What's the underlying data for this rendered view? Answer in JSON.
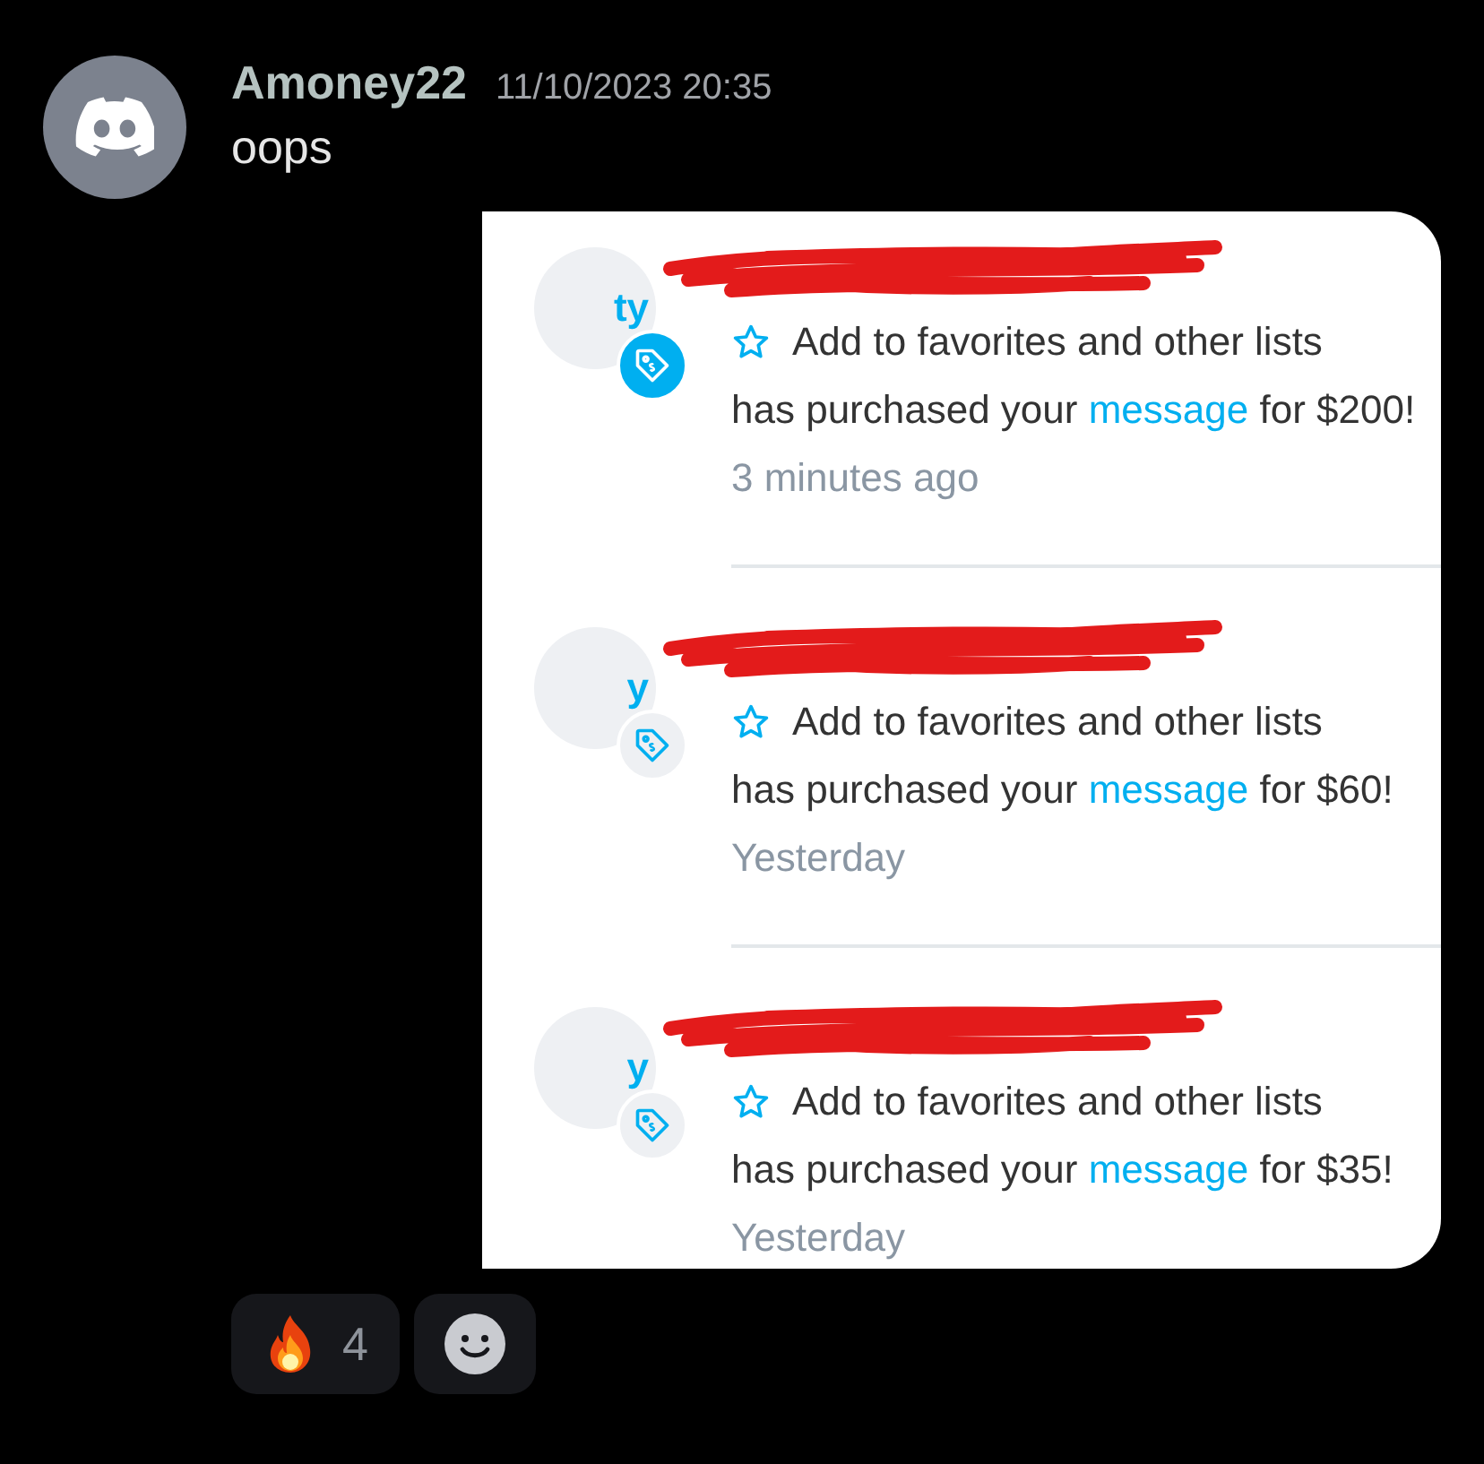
{
  "message": {
    "author": "Amoney22",
    "timestamp": "11/10/2023 20:35",
    "text": "oops"
  },
  "notifications": [
    {
      "avatar_fragment": "ty",
      "kind": "filled",
      "action": "Add to favorites and other lists",
      "before": "has purchased your",
      "link": "message",
      "after": "for $200!",
      "time": "3 minutes ago"
    },
    {
      "avatar_fragment": "y",
      "kind": "plain",
      "action": "Add to favorites and other lists",
      "before": "has purchased your",
      "link": "message",
      "after": "for $60!",
      "time": "Yesterday"
    },
    {
      "avatar_fragment": "y",
      "kind": "plain",
      "action": "Add to favorites and other lists",
      "before": "has purchased your",
      "link": "message",
      "after": "for $35!",
      "time": "Yesterday"
    }
  ],
  "reactions": [
    {
      "kind": "emoji",
      "count": "4"
    },
    {
      "kind": "add"
    }
  ]
}
